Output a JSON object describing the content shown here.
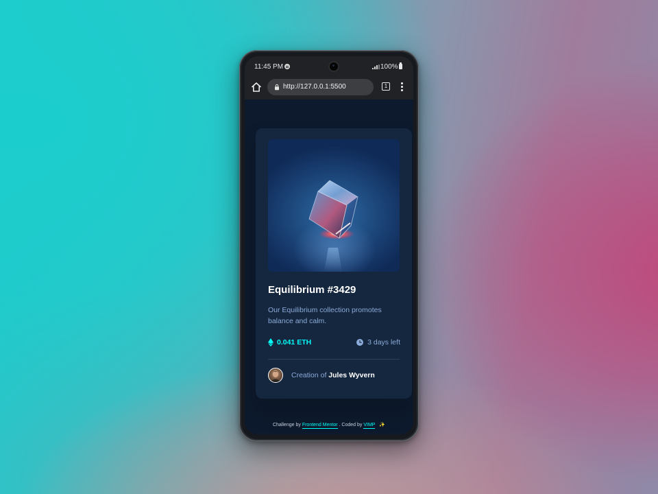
{
  "status_bar": {
    "time": "11:45 PM",
    "battery": "100%"
  },
  "browser": {
    "url": "http://127.0.0.1:5500",
    "tab_count": "1"
  },
  "card": {
    "title": "Equilibrium #3429",
    "description": "Our Equilibrium collection promotes balance and calm.",
    "price": "0.041 ETH",
    "time_left": "3 days left",
    "creator_prefix": "Creation of",
    "creator_name": "Jules Wyvern"
  },
  "footer": {
    "challenge_by": "Challenge by",
    "challenge_link": "Frontend Mentor",
    "coded_by": ". Coded by",
    "coder_link": "VIMP"
  },
  "colors": {
    "page_bg": "#0d1a2d",
    "card_bg": "#15263f",
    "accent_cyan": "#00fff8",
    "soft_blue": "#8bacd9",
    "white": "#ffffff"
  },
  "icons": {
    "home": "home-icon",
    "lock": "lock-icon",
    "tabs": "tabs-icon",
    "menu": "more-vertical-icon",
    "eth": "ethereum-icon",
    "clock": "clock-icon",
    "sparkle": "sparkle-icon"
  }
}
